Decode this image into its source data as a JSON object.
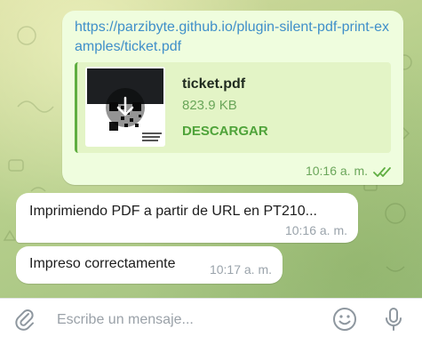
{
  "outgoing_message": {
    "link": "https://parzibyte.github.io/plugin-silent-pdf-print-examples/ticket.pdf",
    "attachment": {
      "file_name": "ticket.pdf",
      "file_size": "823.9 KB",
      "download_label": "DESCARGAR",
      "thumbnail_icon": "pdf-thumbnail-icon",
      "download_icon": "download-arrow-icon"
    },
    "time": "10:16 a. m.",
    "status_icon": "double-check-icon"
  },
  "incoming_messages": [
    {
      "text": "Imprimiendo PDF a partir de URL en PT210...",
      "time": "10:16 a. m."
    },
    {
      "text": "Impreso correctamente",
      "time": "10:17 a. m."
    }
  ],
  "composer": {
    "placeholder": "Escribe un mensaje...",
    "attach_icon": "paperclip-icon",
    "emoji_icon": "smiley-icon",
    "mic_icon": "microphone-icon"
  },
  "colors": {
    "outgoing_bubble": "#effdde",
    "incoming_bubble": "#ffffff",
    "link": "#3f8fc9",
    "accent_green": "#4fa33a",
    "chat_background": "#b7cf8c"
  }
}
